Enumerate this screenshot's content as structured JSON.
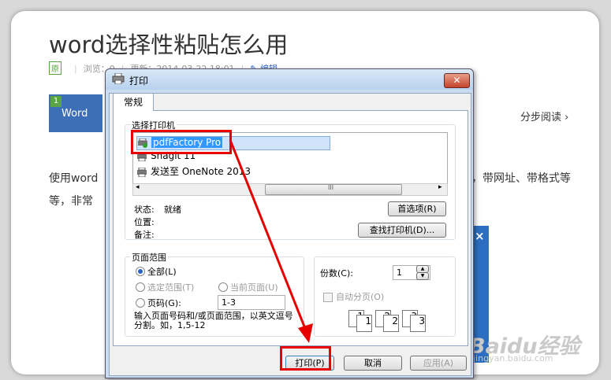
{
  "background_page": {
    "title": "word选择性粘贴怎么用",
    "meta": {
      "badge": "原",
      "views": "浏览：0",
      "updated": "更新：2014-03-22 18:01",
      "edit": "编辑"
    },
    "step": {
      "number": "1",
      "label": "Word"
    },
    "step_read": "分步阅读 ›",
    "intro_left_line1": "使用word",
    "intro_left_line2": "等，非常",
    "intro_right": "，带网址、带格式等",
    "watermark": "Baidu经验",
    "watermark_url": "jingyan.baidu.com",
    "close_icon": "×"
  },
  "dialog": {
    "title": "打印",
    "close_label": "✕",
    "tab": "常规",
    "select_printer_label": "选择打印机",
    "printers": [
      {
        "name": "pdfFactory Pro",
        "selected": true
      },
      {
        "name": "Snagit 11",
        "selected": false
      },
      {
        "name": "发送至 OneNote 2013",
        "selected": false
      }
    ],
    "scroll_left": "◂",
    "scroll_right": "▸",
    "scroll_grip": "III",
    "status_label": "状态:",
    "status_value": "就绪",
    "location_label": "位置:",
    "comment_label": "备注:",
    "preferences_button": "首选项(R)",
    "find_printer_button": "查找打印机(D)...",
    "page_range": {
      "label": "页面范围",
      "all": "全部(L)",
      "selection": "选定范围(T)",
      "current": "当前页面(U)",
      "pages": "页码(G):",
      "pages_value": "1-3",
      "hint": "输入页面号码和/或页面范围，以英文逗号分割。如，1,5-12"
    },
    "copies": {
      "label": "份数(C):",
      "value": "1",
      "collate": "自动分页(O)",
      "collate_icons": [
        "1",
        "1",
        "2",
        "2",
        "3",
        "3"
      ]
    },
    "buttons": {
      "print": "打印(P)",
      "cancel": "取消",
      "apply": "应用(A)"
    }
  },
  "colors": {
    "annotation_red": "#e60000",
    "dialog_frame": "#c9dcf2",
    "selection_blue": "#cfe3fb"
  }
}
